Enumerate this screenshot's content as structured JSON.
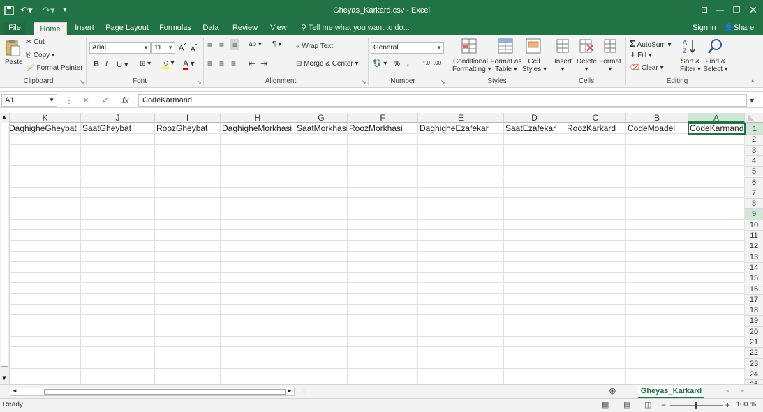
{
  "window": {
    "title": "Gheyas_Karkard.csv - Excel"
  },
  "tabs": [
    "File",
    "Home",
    "Insert",
    "Page Layout",
    "Formulas",
    "Data",
    "Review",
    "View"
  ],
  "tell_me": "Tell me what you want to do...",
  "account": {
    "sign_in": "Sign in",
    "share": "Share"
  },
  "ribbon": {
    "clipboard": {
      "paste": "Paste",
      "cut": "Cut",
      "copy": "Copy",
      "format_painter": "Format Painter",
      "label": "Clipboard"
    },
    "font": {
      "name": "Arial",
      "size": "11",
      "label": "Font"
    },
    "alignment": {
      "wrap_text": "Wrap Text",
      "merge_center": "Merge & Center",
      "label": "Alignment"
    },
    "number": {
      "format": "General",
      "label": "Number"
    },
    "styles": {
      "conditional_1": "Conditional",
      "conditional_2": "Formatting",
      "format_as_1": "Format as",
      "format_as_2": "Table",
      "cell_1": "Cell",
      "cell_2": "Styles",
      "label": "Styles"
    },
    "cells": {
      "insert": "Insert",
      "delete": "Delete",
      "format": "Format",
      "label": "Cells"
    },
    "editing": {
      "autosum": "AutoSum",
      "fill": "Fill",
      "clear": "Clear",
      "sort_1": "Sort &",
      "sort_2": "Filter",
      "find_1": "Find &",
      "find_2": "Select",
      "label": "Editing"
    }
  },
  "formula_bar": {
    "name_box": "A1",
    "content": "CodeKarmand"
  },
  "grid": {
    "columns": [
      "K",
      "J",
      "I",
      "H",
      "G",
      "F",
      "E",
      "D",
      "C",
      "B",
      "A"
    ],
    "headers_row1": [
      "DaghigheGheybat",
      "SaatGheybat",
      "RoozGheybat",
      "DaghigheMorkhasi",
      "SaatMorkhasi",
      "RoozMorkhasi",
      "DaghigheEzafekar",
      "SaatEzafekar",
      "RoozKarkard",
      "CodeMoadel",
      "CodeKarmand"
    ],
    "rows": [
      "1",
      "2",
      "3",
      "4",
      "5",
      "6",
      "7",
      "8",
      "9",
      "10",
      "11",
      "12",
      "13",
      "14",
      "15",
      "16",
      "17",
      "18",
      "19",
      "20",
      "21",
      "22",
      "23",
      "24",
      "25"
    ]
  },
  "sheet": {
    "tab": "Gheyas_Karkard"
  },
  "status": {
    "text": "Ready",
    "zoom": "100 %"
  },
  "colors": {
    "accent": "#217346"
  }
}
